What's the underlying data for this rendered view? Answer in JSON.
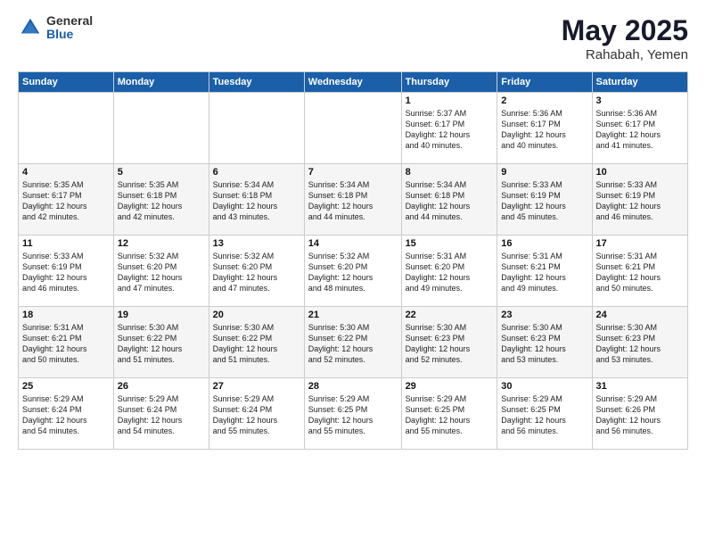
{
  "logo": {
    "general": "General",
    "blue": "Blue"
  },
  "title": {
    "month": "May 2025",
    "location": "Rahabah, Yemen"
  },
  "header": {
    "days": [
      "Sunday",
      "Monday",
      "Tuesday",
      "Wednesday",
      "Thursday",
      "Friday",
      "Saturday"
    ]
  },
  "weeks": [
    [
      {
        "day": "",
        "info": ""
      },
      {
        "day": "",
        "info": ""
      },
      {
        "day": "",
        "info": ""
      },
      {
        "day": "",
        "info": ""
      },
      {
        "day": "1",
        "info": "Sunrise: 5:37 AM\nSunset: 6:17 PM\nDaylight: 12 hours\nand 40 minutes."
      },
      {
        "day": "2",
        "info": "Sunrise: 5:36 AM\nSunset: 6:17 PM\nDaylight: 12 hours\nand 40 minutes."
      },
      {
        "day": "3",
        "info": "Sunrise: 5:36 AM\nSunset: 6:17 PM\nDaylight: 12 hours\nand 41 minutes."
      }
    ],
    [
      {
        "day": "4",
        "info": "Sunrise: 5:35 AM\nSunset: 6:17 PM\nDaylight: 12 hours\nand 42 minutes."
      },
      {
        "day": "5",
        "info": "Sunrise: 5:35 AM\nSunset: 6:18 PM\nDaylight: 12 hours\nand 42 minutes."
      },
      {
        "day": "6",
        "info": "Sunrise: 5:34 AM\nSunset: 6:18 PM\nDaylight: 12 hours\nand 43 minutes."
      },
      {
        "day": "7",
        "info": "Sunrise: 5:34 AM\nSunset: 6:18 PM\nDaylight: 12 hours\nand 44 minutes."
      },
      {
        "day": "8",
        "info": "Sunrise: 5:34 AM\nSunset: 6:18 PM\nDaylight: 12 hours\nand 44 minutes."
      },
      {
        "day": "9",
        "info": "Sunrise: 5:33 AM\nSunset: 6:19 PM\nDaylight: 12 hours\nand 45 minutes."
      },
      {
        "day": "10",
        "info": "Sunrise: 5:33 AM\nSunset: 6:19 PM\nDaylight: 12 hours\nand 46 minutes."
      }
    ],
    [
      {
        "day": "11",
        "info": "Sunrise: 5:33 AM\nSunset: 6:19 PM\nDaylight: 12 hours\nand 46 minutes."
      },
      {
        "day": "12",
        "info": "Sunrise: 5:32 AM\nSunset: 6:20 PM\nDaylight: 12 hours\nand 47 minutes."
      },
      {
        "day": "13",
        "info": "Sunrise: 5:32 AM\nSunset: 6:20 PM\nDaylight: 12 hours\nand 47 minutes."
      },
      {
        "day": "14",
        "info": "Sunrise: 5:32 AM\nSunset: 6:20 PM\nDaylight: 12 hours\nand 48 minutes."
      },
      {
        "day": "15",
        "info": "Sunrise: 5:31 AM\nSunset: 6:20 PM\nDaylight: 12 hours\nand 49 minutes."
      },
      {
        "day": "16",
        "info": "Sunrise: 5:31 AM\nSunset: 6:21 PM\nDaylight: 12 hours\nand 49 minutes."
      },
      {
        "day": "17",
        "info": "Sunrise: 5:31 AM\nSunset: 6:21 PM\nDaylight: 12 hours\nand 50 minutes."
      }
    ],
    [
      {
        "day": "18",
        "info": "Sunrise: 5:31 AM\nSunset: 6:21 PM\nDaylight: 12 hours\nand 50 minutes."
      },
      {
        "day": "19",
        "info": "Sunrise: 5:30 AM\nSunset: 6:22 PM\nDaylight: 12 hours\nand 51 minutes."
      },
      {
        "day": "20",
        "info": "Sunrise: 5:30 AM\nSunset: 6:22 PM\nDaylight: 12 hours\nand 51 minutes."
      },
      {
        "day": "21",
        "info": "Sunrise: 5:30 AM\nSunset: 6:22 PM\nDaylight: 12 hours\nand 52 minutes."
      },
      {
        "day": "22",
        "info": "Sunrise: 5:30 AM\nSunset: 6:23 PM\nDaylight: 12 hours\nand 52 minutes."
      },
      {
        "day": "23",
        "info": "Sunrise: 5:30 AM\nSunset: 6:23 PM\nDaylight: 12 hours\nand 53 minutes."
      },
      {
        "day": "24",
        "info": "Sunrise: 5:30 AM\nSunset: 6:23 PM\nDaylight: 12 hours\nand 53 minutes."
      }
    ],
    [
      {
        "day": "25",
        "info": "Sunrise: 5:29 AM\nSunset: 6:24 PM\nDaylight: 12 hours\nand 54 minutes."
      },
      {
        "day": "26",
        "info": "Sunrise: 5:29 AM\nSunset: 6:24 PM\nDaylight: 12 hours\nand 54 minutes."
      },
      {
        "day": "27",
        "info": "Sunrise: 5:29 AM\nSunset: 6:24 PM\nDaylight: 12 hours\nand 55 minutes."
      },
      {
        "day": "28",
        "info": "Sunrise: 5:29 AM\nSunset: 6:25 PM\nDaylight: 12 hours\nand 55 minutes."
      },
      {
        "day": "29",
        "info": "Sunrise: 5:29 AM\nSunset: 6:25 PM\nDaylight: 12 hours\nand 55 minutes."
      },
      {
        "day": "30",
        "info": "Sunrise: 5:29 AM\nSunset: 6:25 PM\nDaylight: 12 hours\nand 56 minutes."
      },
      {
        "day": "31",
        "info": "Sunrise: 5:29 AM\nSunset: 6:26 PM\nDaylight: 12 hours\nand 56 minutes."
      }
    ]
  ]
}
